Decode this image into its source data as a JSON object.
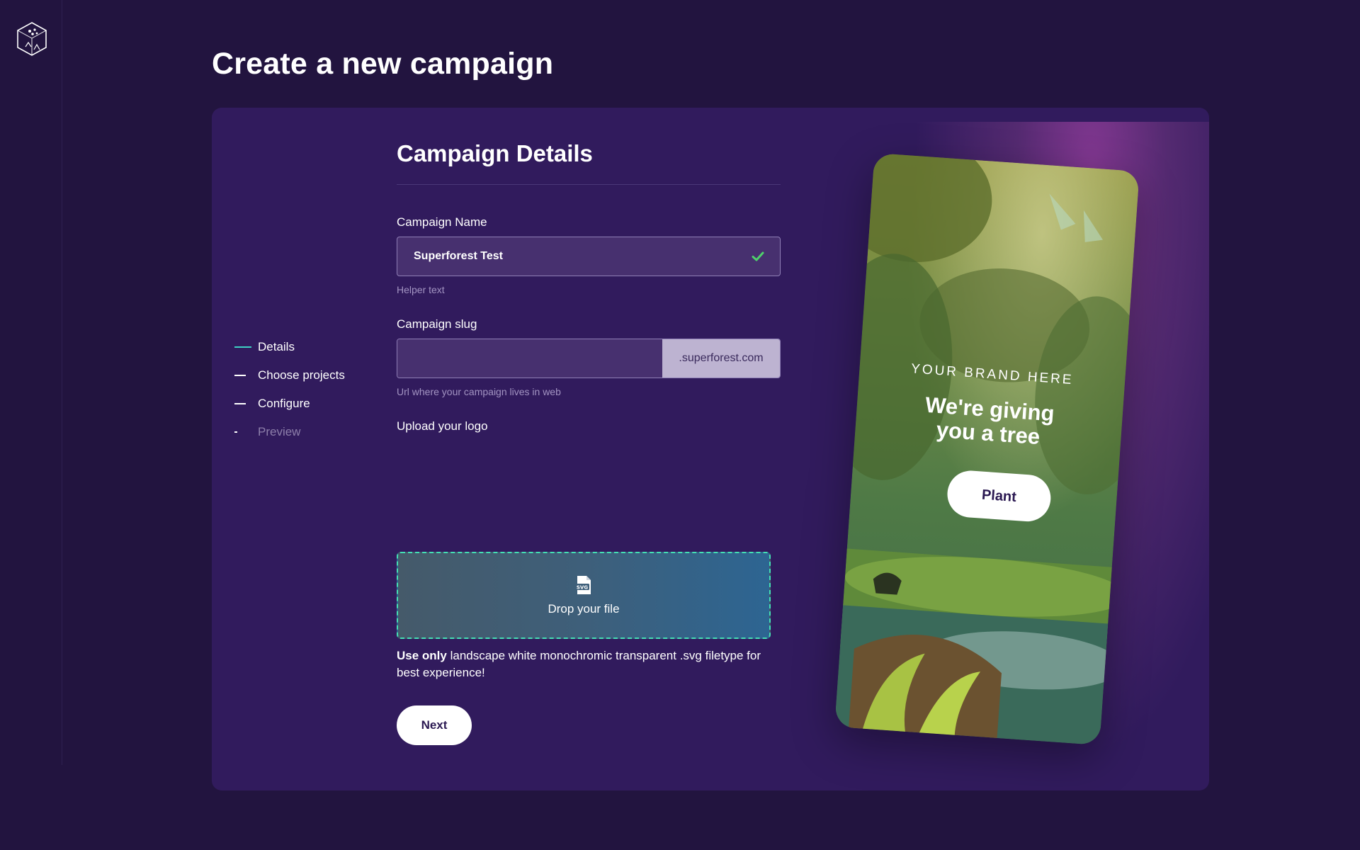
{
  "page": {
    "title": "Create a new campaign"
  },
  "steps": [
    {
      "label": "Details",
      "state": "active"
    },
    {
      "label": "Choose projects",
      "state": "default"
    },
    {
      "label": "Configure",
      "state": "default"
    },
    {
      "label": "Preview",
      "state": "disabled"
    }
  ],
  "form": {
    "title": "Campaign Details",
    "name": {
      "label": "Campaign Name",
      "value": "Superforest Test",
      "helper": "Helper text",
      "valid": true
    },
    "slug": {
      "label": "Campaign slug",
      "value": "",
      "suffix": ".superforest.com",
      "helper": "Url where your campaign lives in web"
    },
    "logo": {
      "label": "Upload your logo",
      "drop_text": "Drop your file",
      "file_icon": "svg-file-icon",
      "note_bold": "Use only",
      "note_rest": " landscape white monochromic transparent .svg filetype for best experience!"
    },
    "next_label": "Next"
  },
  "preview": {
    "brand": "YOUR BRAND HERE",
    "headline_line1": "We're giving",
    "headline_line2": "you a tree",
    "cta": "Plant"
  },
  "colors": {
    "background": "#22143f",
    "card": "#311b5d",
    "accent": "#3ed1c4",
    "valid": "#4fd16b"
  }
}
